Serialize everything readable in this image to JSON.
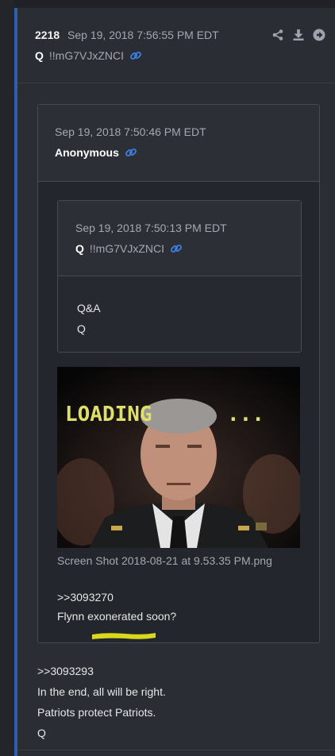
{
  "post": {
    "number": "2218",
    "date": "Sep 19, 2018 7:56:55 PM EDT",
    "author": "Q",
    "tripcode": "!!mG7VJxZNCI",
    "body_lines": [
      ">>3093293",
      "In the end, all will be right.",
      "Patriots protect Patriots.",
      "Q"
    ]
  },
  "quoted": {
    "date": "Sep 19, 2018 7:50:46 PM EDT",
    "author": "Anonymous",
    "inner": {
      "date": "Sep 19, 2018 7:50:13 PM EDT",
      "author": "Q",
      "tripcode": "!!mG7VJxZNCI",
      "body_lines": [
        "Q&A",
        "Q"
      ]
    },
    "image": {
      "overlay_text": "LOADING",
      "dots": "...",
      "caption": "Screen Shot 2018-08-21 at 9.53.35 PM.png"
    },
    "body_lines": [
      ">>3093270",
      "Flynn exonerated soon?"
    ]
  },
  "icons": [
    "share-icon",
    "download-icon",
    "arrow-right-icon",
    "link-icon"
  ],
  "colors": {
    "background": "#2a2d34",
    "accent": "#2f5fb0",
    "link": "#3b7ddd",
    "muted_text": "#a3a8b2",
    "highlight": "#d8d81c"
  }
}
